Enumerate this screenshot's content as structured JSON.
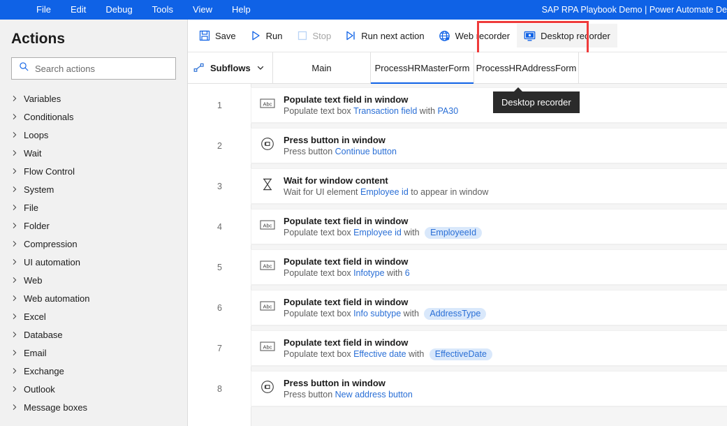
{
  "titlebar": {
    "menu": [
      {
        "label": "File"
      },
      {
        "label": "Edit"
      },
      {
        "label": "Debug"
      },
      {
        "label": "Tools"
      },
      {
        "label": "View"
      },
      {
        "label": "Help"
      }
    ],
    "document_title": "SAP RPA Playbook Demo | Power Automate De",
    "bg_color": "#0f62e6"
  },
  "sidebar": {
    "heading": "Actions",
    "search": {
      "placeholder": "Search actions",
      "value": "",
      "icon": "search-icon"
    },
    "categories": [
      {
        "label": "Variables",
        "icon": "chevron-right-icon"
      },
      {
        "label": "Conditionals",
        "icon": "chevron-right-icon"
      },
      {
        "label": "Loops",
        "icon": "chevron-right-icon"
      },
      {
        "label": "Wait",
        "icon": "chevron-right-icon"
      },
      {
        "label": "Flow Control",
        "icon": "chevron-right-icon"
      },
      {
        "label": "System",
        "icon": "chevron-right-icon"
      },
      {
        "label": "File",
        "icon": "chevron-right-icon"
      },
      {
        "label": "Folder",
        "icon": "chevron-right-icon"
      },
      {
        "label": "Compression",
        "icon": "chevron-right-icon"
      },
      {
        "label": "UI automation",
        "icon": "chevron-right-icon"
      },
      {
        "label": "Web",
        "icon": "chevron-right-icon"
      },
      {
        "label": "Web automation",
        "icon": "chevron-right-icon"
      },
      {
        "label": "Excel",
        "icon": "chevron-right-icon"
      },
      {
        "label": "Database",
        "icon": "chevron-right-icon"
      },
      {
        "label": "Email",
        "icon": "chevron-right-icon"
      },
      {
        "label": "Exchange",
        "icon": "chevron-right-icon"
      },
      {
        "label": "Outlook",
        "icon": "chevron-right-icon"
      },
      {
        "label": "Message boxes",
        "icon": "chevron-right-icon"
      }
    ]
  },
  "toolbar": {
    "save_label": "Save",
    "run_label": "Run",
    "stop_label": "Stop",
    "run_next_label": "Run next action",
    "web_recorder_label": "Web recorder",
    "desktop_recorder_label": "Desktop recorder",
    "highlight_color": "#ef3b3b",
    "accent_color": "#0f62e6"
  },
  "tooltip": {
    "text": "Desktop recorder"
  },
  "tabs": {
    "subflows_label": "Subflows",
    "items": [
      {
        "label": "Main",
        "active": false
      },
      {
        "label": "ProcessHRMasterForm",
        "active": true
      },
      {
        "label": "ProcessHRAddressForm",
        "active": false
      }
    ]
  },
  "workspace": {
    "actions": [
      {
        "number": "1",
        "icon": "abc-textbox-icon",
        "title": "Populate text field in window",
        "parts": [
          {
            "t": "text",
            "v": "Populate text box "
          },
          {
            "t": "link",
            "v": "Transaction field"
          },
          {
            "t": "text",
            "v": " with "
          },
          {
            "t": "link",
            "v": "PA30"
          }
        ]
      },
      {
        "number": "2",
        "icon": "press-button-icon",
        "title": "Press button in window",
        "parts": [
          {
            "t": "text",
            "v": "Press button "
          },
          {
            "t": "link",
            "v": "Continue button"
          }
        ]
      },
      {
        "number": "3",
        "icon": "hourglass-icon",
        "title": "Wait for window content",
        "parts": [
          {
            "t": "text",
            "v": "Wait for UI element "
          },
          {
            "t": "link",
            "v": "Employee id"
          },
          {
            "t": "text",
            "v": " to appear in window"
          }
        ]
      },
      {
        "number": "4",
        "icon": "abc-textbox-icon",
        "title": "Populate text field in window",
        "parts": [
          {
            "t": "text",
            "v": "Populate text box "
          },
          {
            "t": "link",
            "v": "Employee id"
          },
          {
            "t": "text",
            "v": " with "
          },
          {
            "t": "chip",
            "v": "EmployeeId"
          }
        ]
      },
      {
        "number": "5",
        "icon": "abc-textbox-icon",
        "title": "Populate text field in window",
        "parts": [
          {
            "t": "text",
            "v": "Populate text box "
          },
          {
            "t": "link",
            "v": "Infotype"
          },
          {
            "t": "text",
            "v": " with "
          },
          {
            "t": "link",
            "v": "6"
          }
        ]
      },
      {
        "number": "6",
        "icon": "abc-textbox-icon",
        "title": "Populate text field in window",
        "parts": [
          {
            "t": "text",
            "v": "Populate text box "
          },
          {
            "t": "link",
            "v": "Info subtype"
          },
          {
            "t": "text",
            "v": " with "
          },
          {
            "t": "chip",
            "v": "AddressType"
          }
        ]
      },
      {
        "number": "7",
        "icon": "abc-textbox-icon",
        "title": "Populate text field in window",
        "parts": [
          {
            "t": "text",
            "v": "Populate text box "
          },
          {
            "t": "link",
            "v": "Effective date"
          },
          {
            "t": "text",
            "v": " with "
          },
          {
            "t": "chip",
            "v": "EffectiveDate"
          }
        ]
      },
      {
        "number": "8",
        "icon": "press-button-icon",
        "title": "Press button in window",
        "parts": [
          {
            "t": "text",
            "v": "Press button "
          },
          {
            "t": "link",
            "v": "New address button"
          }
        ]
      }
    ]
  }
}
